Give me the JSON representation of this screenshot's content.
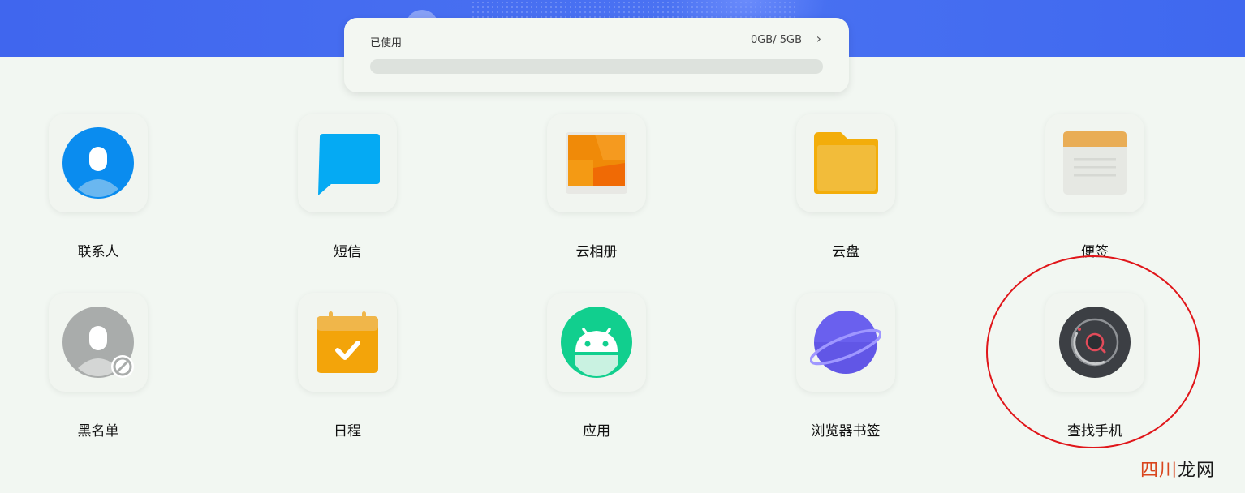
{
  "storage": {
    "label": "已使用",
    "value": "0GB/ 5GB",
    "used_fraction": 0
  },
  "apps": [
    {
      "label": "联系人",
      "icon": "contacts-icon"
    },
    {
      "label": "短信",
      "icon": "messages-icon"
    },
    {
      "label": "云相册",
      "icon": "cloud-album-icon"
    },
    {
      "label": "云盘",
      "icon": "cloud-drive-icon"
    },
    {
      "label": "便签",
      "icon": "notes-icon"
    },
    {
      "label": "黑名单",
      "icon": "blacklist-icon"
    },
    {
      "label": "日程",
      "icon": "calendar-icon"
    },
    {
      "label": "应用",
      "icon": "android-apps-icon"
    },
    {
      "label": "浏览器书签",
      "icon": "browser-bookmarks-icon"
    },
    {
      "label": "查找手机",
      "icon": "find-phone-icon"
    }
  ],
  "watermark": {
    "part1": "四川",
    "part2": "龙网"
  },
  "colors": {
    "banner": "#4066ee",
    "background": "#f2f7f2",
    "highlight": "#e0161a"
  }
}
